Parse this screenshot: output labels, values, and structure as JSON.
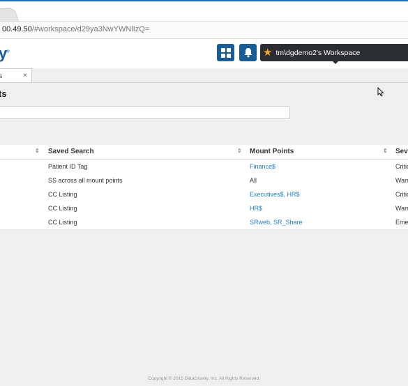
{
  "browser": {
    "address": "00.49.50",
    "address_path": "/#workspace/d29ya3NwYWNlIzQ="
  },
  "app": {
    "logo_fragment": "y",
    "logo_mark": "®",
    "workspace_label": "tm\\dgdemo2's Workspace"
  },
  "tabs": [
    {
      "label": "s",
      "close": "×"
    }
  ],
  "page": {
    "title": "ts"
  },
  "table": {
    "columns": [
      "Saved Search",
      "Mount Points",
      "Sev"
    ],
    "sort_glyph": "⇕",
    "rows": [
      {
        "saved_search": "Patient ID Tag",
        "mount_points": "Finance$",
        "mount_link": true,
        "severity": "Critic"
      },
      {
        "saved_search": "SS across all mount points",
        "mount_points": "All",
        "mount_link": false,
        "severity": "Warn"
      },
      {
        "saved_search": "CC Listing",
        "mount_points": "Executives$, HR$",
        "mount_link": true,
        "severity": "Critic"
      },
      {
        "saved_search": "CC Listing",
        "mount_points": "HR$",
        "mount_link": true,
        "severity": "Warn"
      },
      {
        "saved_search": "CC Listing",
        "mount_points": "SRweb, SR_Share",
        "mount_link": true,
        "severity": "Eme"
      }
    ]
  },
  "footer": "Copyright © 2015 DataGravity, Inc. All Rights Reserved.",
  "colors": {
    "brand": "#1a5d96",
    "link": "#1e7fc4",
    "workspace_bg": "#2b2d31",
    "star": "#f2a92c"
  },
  "icons": [
    "grid-icon",
    "bell-icon",
    "star-icon",
    "close-icon",
    "sort-icon",
    "mouse-cursor-icon"
  ]
}
